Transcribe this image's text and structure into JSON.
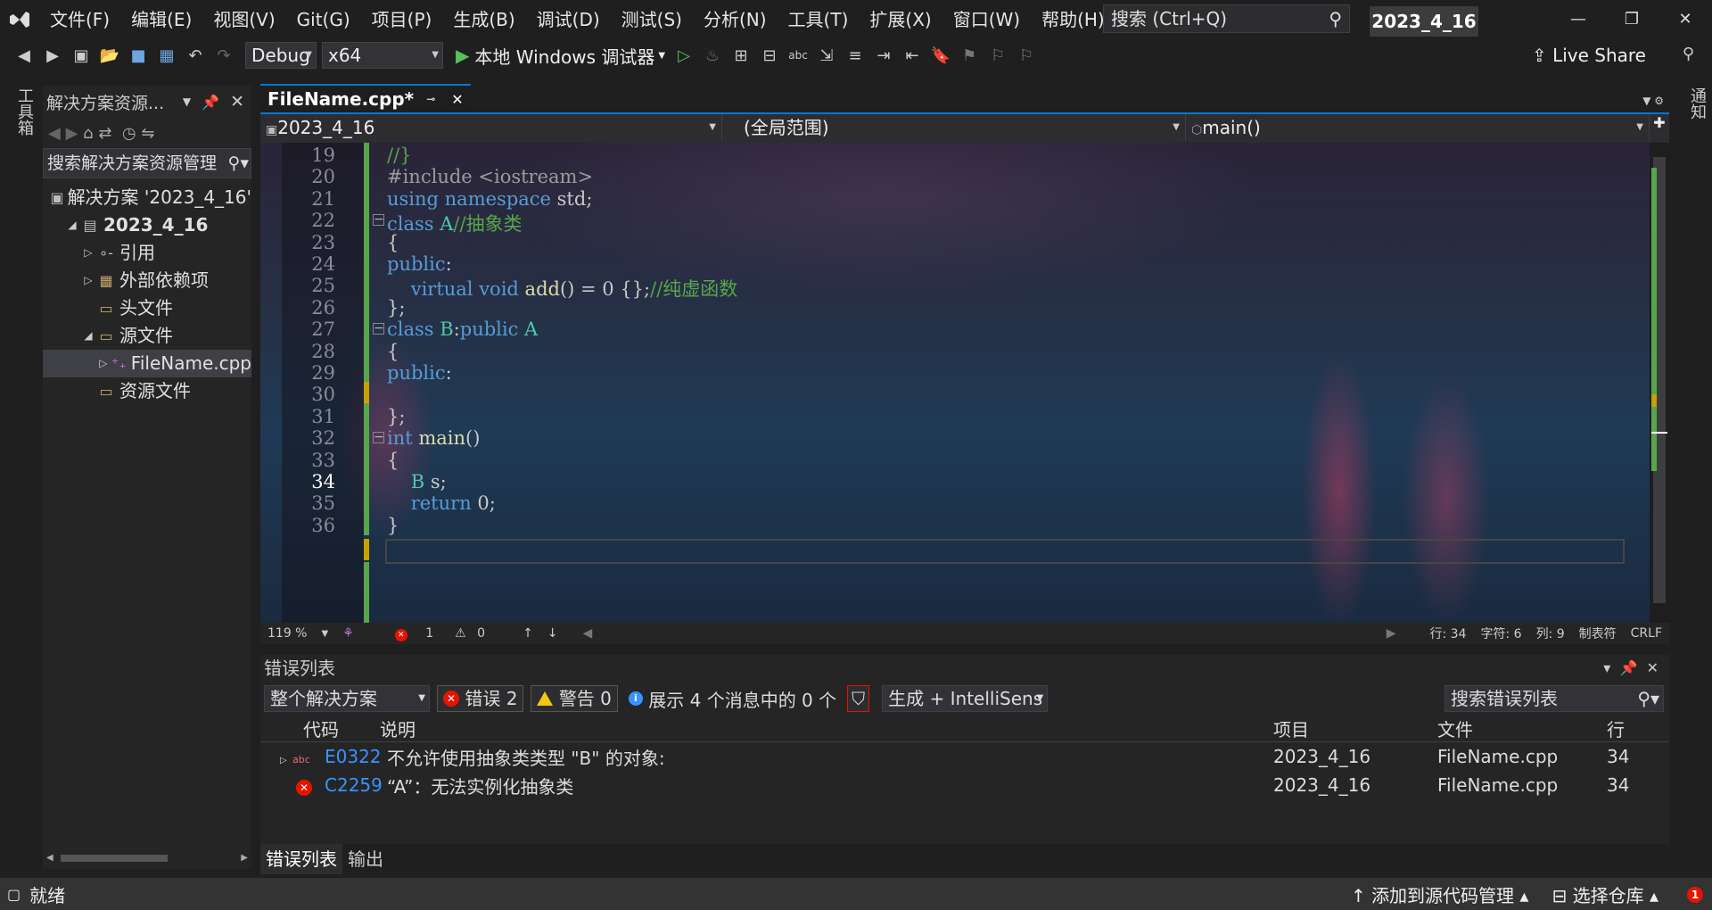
{
  "menubar": {
    "items": [
      "文件(F)",
      "编辑(E)",
      "视图(V)",
      "Git(G)",
      "项目(P)",
      "生成(B)",
      "调试(D)",
      "测试(S)",
      "分析(N)",
      "工具(T)",
      "扩展(X)",
      "窗口(W)",
      "帮助(H)"
    ],
    "search_placeholder": "搜索 (Ctrl+Q)",
    "solution_title": "2023_4_16"
  },
  "toolbar": {
    "config": "Debug",
    "platform": "x64",
    "run_label": "本地 Windows 调试器",
    "live_share": "Live Share"
  },
  "left_strip": {
    "label": "工具箱"
  },
  "right_strip": {
    "label": "通知"
  },
  "solution_explorer": {
    "title": "解决方案资源...",
    "search": "搜索解决方案资源管理",
    "tree": [
      {
        "label": "解决方案 '2023_4_16'",
        "indent": 0,
        "tw": "",
        "icon": "solution-icon"
      },
      {
        "label": "2023_4_16",
        "indent": 1,
        "tw": "◢",
        "icon": "project-icon",
        "bold": true
      },
      {
        "label": "引用",
        "indent": 2,
        "tw": "▷",
        "icon": "references-icon"
      },
      {
        "label": "外部依赖项",
        "indent": 2,
        "tw": "▷",
        "icon": "external-deps-icon"
      },
      {
        "label": "头文件",
        "indent": 2,
        "tw": "",
        "icon": "filter-folder-icon"
      },
      {
        "label": "源文件",
        "indent": 2,
        "tw": "◢",
        "icon": "filter-folder-icon"
      },
      {
        "label": "FileName.cpp",
        "indent": 3,
        "tw": "▷",
        "icon": "cpp-file-icon",
        "selected": true
      },
      {
        "label": "资源文件",
        "indent": 2,
        "tw": "",
        "icon": "filter-folder-icon"
      }
    ]
  },
  "editor": {
    "tab": "FileName.cpp*",
    "nav_project": "2023_4_16",
    "nav_scope": "(全局范围)",
    "nav_member": "main()",
    "lines": [
      {
        "n": "19",
        "code": [
          [
            "cm",
            "//}"
          ]
        ]
      },
      {
        "n": "20",
        "code": [
          [
            "pp",
            "#include <iostream>"
          ]
        ]
      },
      {
        "n": "21",
        "code": [
          [
            "kw",
            "using namespace "
          ],
          [
            "",
            "std;"
          ]
        ]
      },
      {
        "n": "22",
        "code": [
          [
            "kw",
            "class "
          ],
          [
            "ty",
            "A"
          ],
          [
            "cm",
            "//抽象类"
          ]
        ],
        "fold": true
      },
      {
        "n": "23",
        "code": [
          [
            "",
            "{"
          ]
        ]
      },
      {
        "n": "24",
        "code": [
          [
            "kw",
            "public"
          ],
          [
            "",
            ":"
          ]
        ]
      },
      {
        "n": "25",
        "code": [
          [
            "",
            "    "
          ],
          [
            "kw",
            "virtual void "
          ],
          [
            "fn",
            "add"
          ],
          [
            "",
            "() = 0 {};"
          ],
          [
            "cm",
            "//纯虚函数"
          ]
        ]
      },
      {
        "n": "26",
        "code": [
          [
            "",
            "};"
          ]
        ]
      },
      {
        "n": "27",
        "code": [
          [
            "kw",
            "class "
          ],
          [
            "ty",
            "B"
          ],
          [
            "",
            ":"
          ],
          [
            "kw",
            "public "
          ],
          [
            "ty",
            "A"
          ]
        ],
        "fold": true
      },
      {
        "n": "28",
        "code": [
          [
            "",
            "{"
          ]
        ]
      },
      {
        "n": "29",
        "code": [
          [
            "kw",
            "public"
          ],
          [
            "",
            ":"
          ]
        ]
      },
      {
        "n": "30",
        "code": [
          [
            "",
            ""
          ]
        ]
      },
      {
        "n": "31",
        "code": [
          [
            "",
            "};"
          ]
        ]
      },
      {
        "n": "32",
        "code": [
          [
            "kw",
            "int "
          ],
          [
            "fn",
            "main"
          ],
          [
            "",
            "()"
          ]
        ],
        "fold": true
      },
      {
        "n": "33",
        "code": [
          [
            "",
            "{"
          ]
        ]
      },
      {
        "n": "34",
        "code": [
          [
            "",
            "    "
          ],
          [
            "ty",
            "B "
          ],
          [
            "",
            "s;"
          ]
        ]
      },
      {
        "n": "35",
        "code": [
          [
            "",
            "    "
          ],
          [
            "kw",
            "return "
          ],
          [
            "",
            "0;"
          ]
        ]
      },
      {
        "n": "36",
        "code": [
          [
            "",
            "}"
          ]
        ]
      }
    ],
    "status": {
      "zoom": "119 %",
      "errors": "1",
      "warnings": "0",
      "line": "行: 34",
      "char": "字符: 6",
      "col": "列: 9",
      "tab": "制表符",
      "eol": "CRLF"
    }
  },
  "error_list": {
    "title": "错误列表",
    "scope": "整个解决方案",
    "errors_btn": "错误 2",
    "warnings_btn": "警告 0",
    "messages": "展示 4 个消息中的 0 个",
    "build": "生成 + IntelliSens",
    "search": "搜索错误列表",
    "columns": {
      "code": "代码",
      "desc": "说明",
      "project": "项目",
      "file": "文件",
      "line": "行"
    },
    "rows": [
      {
        "code": "E0322",
        "desc": "不允许使用抽象类类型 \"B\" 的对象:",
        "project": "2023_4_16",
        "file": "FileName.cpp",
        "line": "34",
        "kind": "intellisense"
      },
      {
        "code": "C2259",
        "desc": "“A”：无法实例化抽象类",
        "project": "2023_4_16",
        "file": "FileName.cpp",
        "line": "34",
        "kind": "error"
      }
    ]
  },
  "bottom_tabs": [
    "错误列表",
    "输出"
  ],
  "statusbar": {
    "ready": "就绪",
    "source_control": "添加到源代码管理",
    "repo": "选择仓库"
  }
}
